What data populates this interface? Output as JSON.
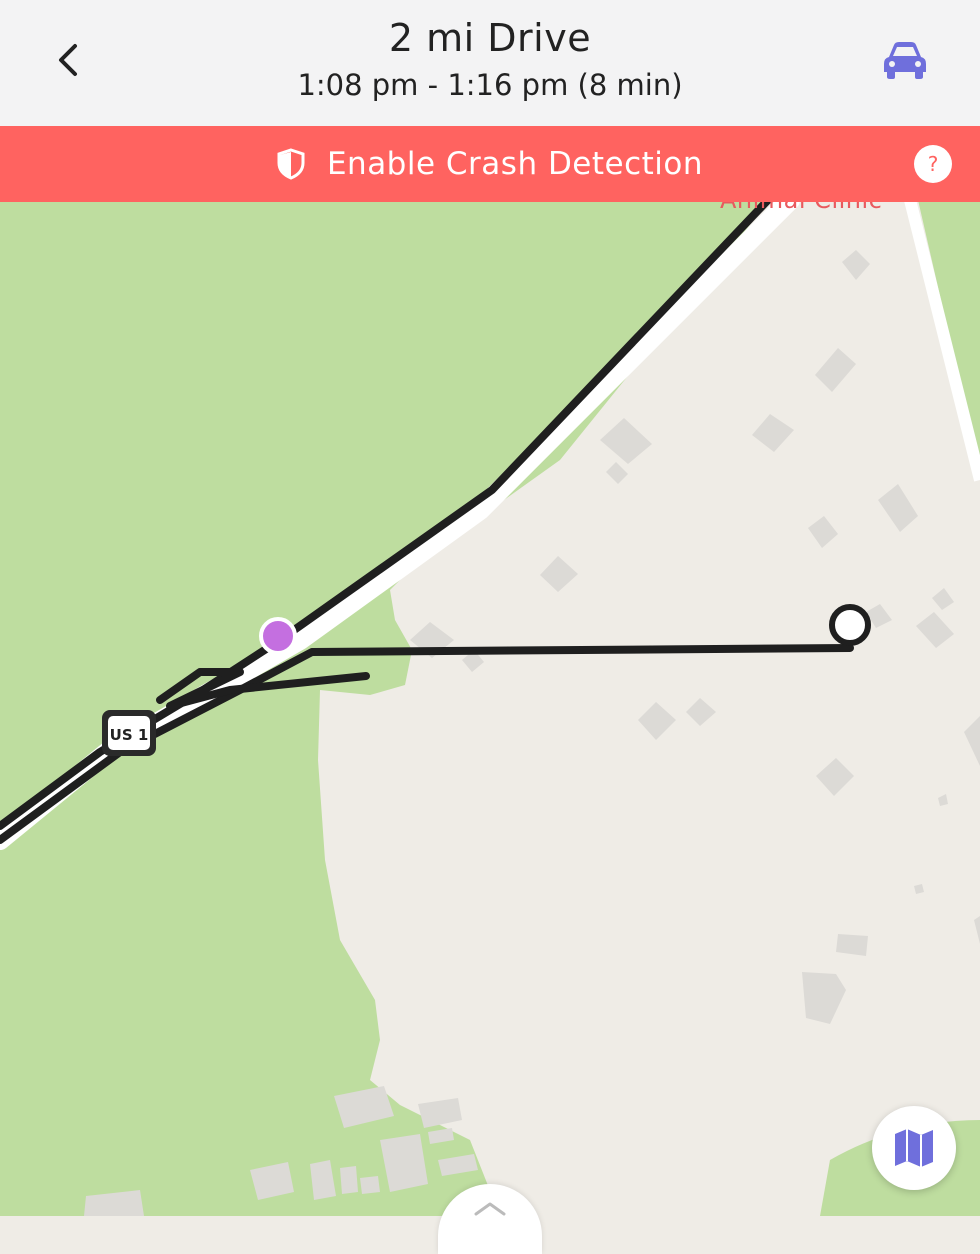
{
  "header": {
    "title": "2 mi Drive",
    "subtitle": "1:08 pm - 1:16 pm (8 min)",
    "back_icon": "chevron-left-icon",
    "mode_icon": "car-icon",
    "icon_color": "#6f6fdc"
  },
  "banner": {
    "text": "Enable Crash Detection",
    "icon": "shield-icon",
    "help_label": "?",
    "background": "#ff6360"
  },
  "map": {
    "poi_label": "Animal Clinic",
    "route_shield_label": "US 1",
    "start_marker_color": "#c46fe0",
    "end_marker": "open-circle",
    "layers_icon": "map-icon",
    "colors": {
      "land": "#efece6",
      "park": "#bedd9f",
      "road": "#ffffff",
      "building": "#dcdad6",
      "route": "#1f1f1f"
    }
  }
}
